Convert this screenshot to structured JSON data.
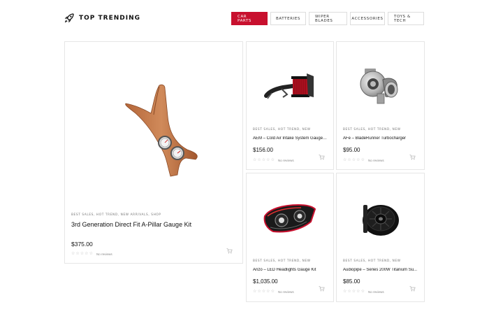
{
  "brand": {
    "name": "TOP TRENDING",
    "logo_icon": "rocket-icon"
  },
  "nav": {
    "tabs": [
      {
        "label": "CAR PARTS",
        "active": true
      },
      {
        "label": "BATTERIES",
        "active": false
      },
      {
        "label": "WIPER BLADES",
        "active": false
      },
      {
        "label": "ACCESSORIES",
        "active": false
      },
      {
        "label": "TOYS & TECH",
        "active": false
      }
    ]
  },
  "colors": {
    "accent": "#c8102e",
    "border": "#e6e6e6"
  },
  "products": [
    {
      "tags": "BEST SALES, HOT TREND, NEW ARRIVALS, SHOP",
      "title": "3rd Generation Direct Fit A-Pillar Gauge Kit",
      "price": "$375.00",
      "reviews": "No reviews",
      "rating": 0,
      "image": "a-pillar-gauge-pod"
    },
    {
      "tags": "BEST SALES, HOT TREND, NEW",
      "title": "AEM – Cold Air Intake System Gauge Kit",
      "price": "$156.00",
      "reviews": "No reviews",
      "rating": 0,
      "image": "cold-air-intake"
    },
    {
      "tags": "BEST SALES, HOT TREND, NEW",
      "title": "AFe – BladeRunner Turbocharger",
      "price": "$95.00",
      "reviews": "No reviews",
      "rating": 0,
      "image": "turbocharger"
    },
    {
      "tags": "BEST SALES, HOT TREND, NEW",
      "title": "Anzo – LED Headlights Gauge Kit",
      "price": "$1,035.00",
      "reviews": "No reviews",
      "rating": 0,
      "image": "led-headlight"
    },
    {
      "tags": "BEST SALES, HOT TREND, NEW",
      "title": "Audiopipe – Series 200W Titanium Su...",
      "price": "$85.00",
      "reviews": "No reviews",
      "rating": 0,
      "image": "subwoofer"
    }
  ]
}
